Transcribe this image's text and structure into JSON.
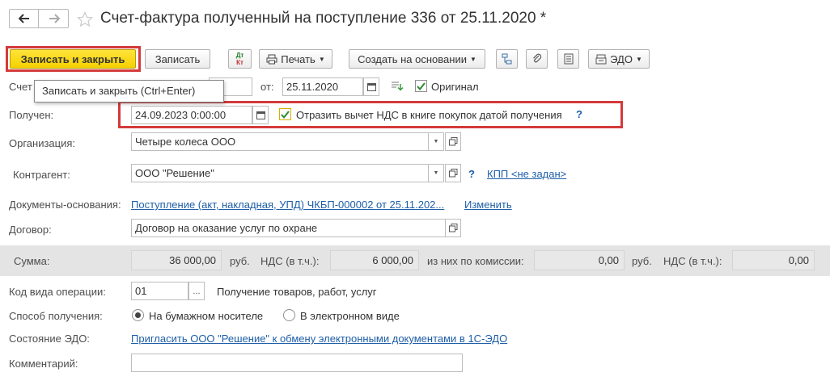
{
  "header": {
    "title": "Счет-фактура полученный на поступление 336 от 25.11.2020 *"
  },
  "toolbar": {
    "save_close": "Записать и закрыть",
    "save": "Записать",
    "print": "Печать",
    "create_based": "Создать на основании",
    "edo": "ЭДО",
    "dt_kt_top": "Дт",
    "dt_kt_bottom": "Кт"
  },
  "tooltip": "Записать и закрыть (Ctrl+Enter)",
  "fields": {
    "invoice_label": "Счет",
    "from_label": "от:",
    "invoice_date": "25.11.2020",
    "original_label": "Оригинал",
    "original_checked": true,
    "received_label": "Получен:",
    "received_value": "24.09.2023  0:00:00",
    "vat_deduction_label": "Отразить вычет НДС в книге покупок датой получения",
    "vat_deduction_checked": true,
    "org_label": "Организация:",
    "org_value": "Четыре колеса ООО",
    "contractor_label": "Контрагент:",
    "contractor_value": "ООО \"Решение\"",
    "kpp_link": "КПП <не задан>",
    "basis_label": "Документы-основания:",
    "basis_link": "Поступление (акт, накладная, УПД) ЧКБП-000002 от 25.11.202...",
    "change_link": "Изменить",
    "contract_label": "Договор:",
    "contract_value": "Договор на оказание услуг по охране",
    "op_code_label": "Код вида операции:",
    "op_code_value": "01",
    "op_code_desc": "Получение товаров, работ, услуг",
    "method_label": "Способ получения:",
    "method_paper": "На бумажном носителе",
    "method_electronic": "В электронном виде",
    "method_selected": "paper",
    "edo_state_label": "Состояние ЭДО:",
    "edo_state_link": "Пригласить ООО \"Решение\" к обмену электронными документами в 1С-ЭДО",
    "comment_label": "Комментарий:",
    "comment_value": ""
  },
  "sum": {
    "label": "Сумма:",
    "amount": "36 000,00",
    "currency": "руб.",
    "vat_label": "НДС (в т.ч.):",
    "vat_amount": "6 000,00",
    "commission_label": "из них по комиссии:",
    "commission_amount": "0,00",
    "commission_currency": "руб.",
    "commission_vat_label": "НДС (в т.ч.):",
    "commission_vat_amount": "0,00"
  },
  "help_mark": "?",
  "colors": {
    "primary_button": "#f5d100",
    "highlight_border": "#d43a3a",
    "link": "#1e5ea8"
  }
}
